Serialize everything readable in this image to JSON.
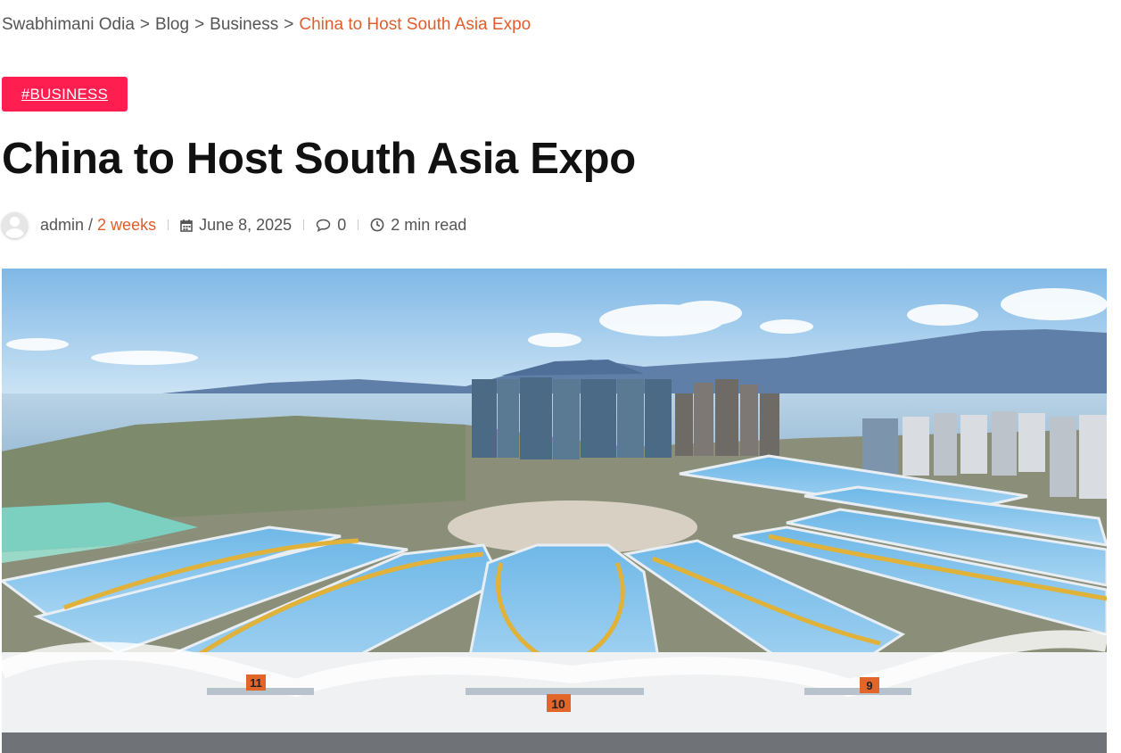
{
  "breadcrumb": {
    "items": [
      "Swabhimani Odia",
      "Blog",
      "Business"
    ],
    "separator": ">",
    "current": "China to Host South Asia Expo"
  },
  "post": {
    "category_tag": "#BUSINESS",
    "title": "China to Host South Asia Expo",
    "author": "admin",
    "slash": "/",
    "relative_time": "2 weeks",
    "date": "June 8, 2025",
    "comments": "0",
    "read_time": "2 min read"
  },
  "hero_image": {
    "hall_numbers": [
      "11",
      "10",
      "9"
    ]
  },
  "colors": {
    "accent": "#e05d2c",
    "tag_bg": "#ff1e4f",
    "title": "#111111",
    "meta_text": "#555555"
  },
  "icons": [
    "avatar",
    "calendar-icon",
    "comment-icon",
    "clock-icon"
  ]
}
